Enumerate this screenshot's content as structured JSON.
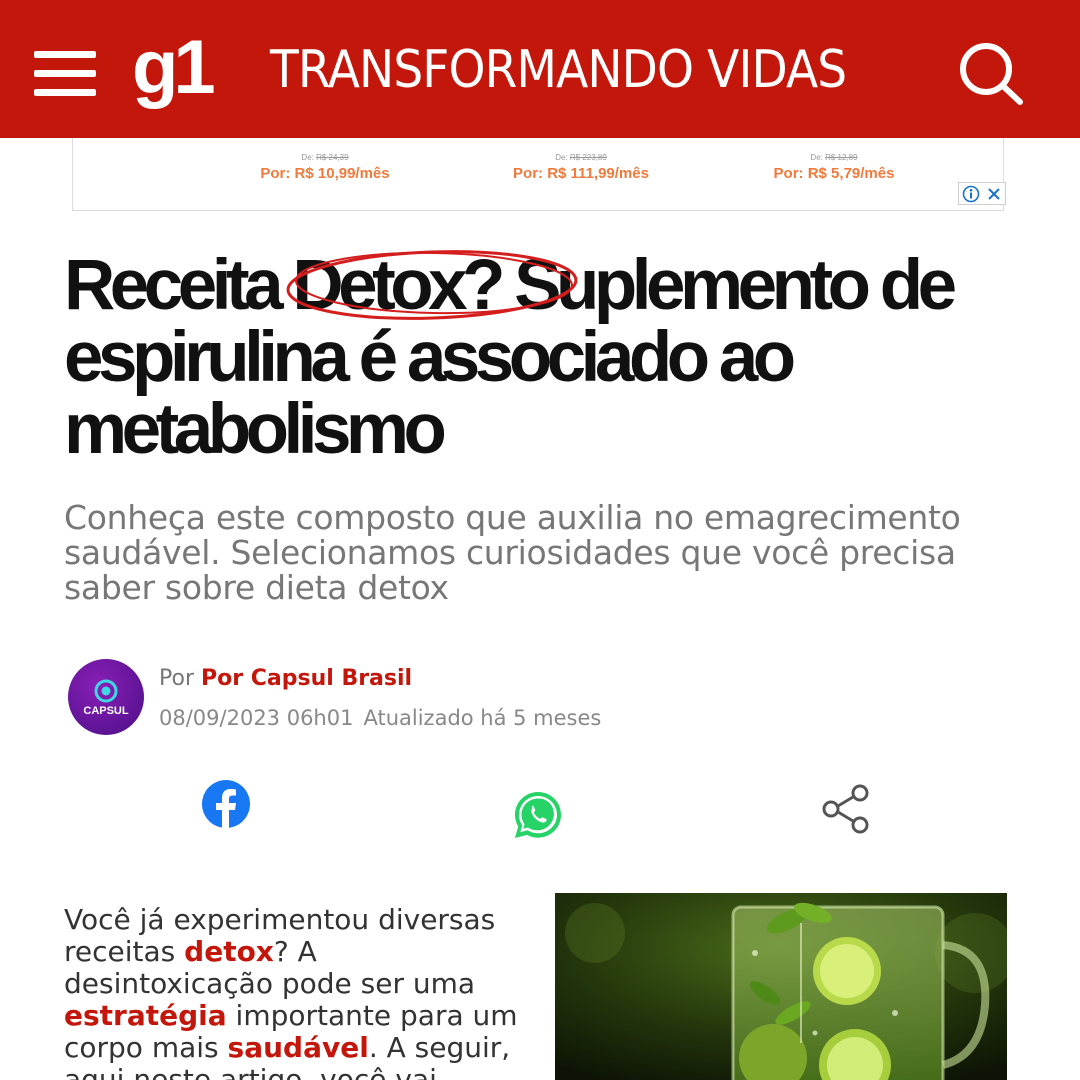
{
  "header": {
    "logo": "g1",
    "section": "TRANSFORMANDO VIDAS",
    "bg_color": "#c4170c"
  },
  "ad": {
    "offers": [
      {
        "old_prefix": "De:",
        "old_price": "R$ 24,39",
        "new_price": "Por: R$ 10,99/mês"
      },
      {
        "old_prefix": "De:",
        "old_price": "R$ 223,89",
        "new_price": "Por: R$ 111,99/mês"
      },
      {
        "old_prefix": "De:",
        "old_price": "R$ 12,89",
        "new_price": "Por: R$ 5,79/mês"
      }
    ]
  },
  "article": {
    "headline": "Receita Detox? Suplemento de espirulina é associado ao metabolismo",
    "subtitle": "Conheça este composto que auxilia no emagrecimento saudável. Selecionamos curiosidades que você precisa saber sobre dieta detox",
    "author": {
      "prefix": "Por",
      "name": "Por Capsul Brasil",
      "avatar_text": "CAPSUL",
      "avatar_color": "#5a1596"
    },
    "date": "08/09/2023 06h01",
    "updated": "Atualizado há 5 meses",
    "share": [
      "facebook-icon",
      "whatsapp-icon",
      "share-icon"
    ],
    "body": {
      "t1": "Você já experimentou diversas receitas ",
      "l1": "detox",
      "t2": "? A desintoxicação pode ser uma ",
      "l2": "estratégia",
      "t3": " importante para um corpo mais ",
      "l3": "saudável",
      "t4": ". A seguir, aqui neste artigo, você vai conhecer um"
    }
  },
  "colors": {
    "accent": "#c4170c",
    "facebook": "#1877f2",
    "whatsapp": "#25d366"
  }
}
